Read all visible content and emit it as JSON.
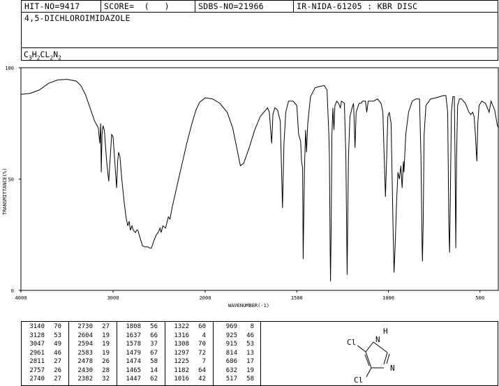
{
  "header": {
    "hit_no": "HIT-NO=9417",
    "score": "SCORE=  (   )",
    "sdbs_no": "SDBS-NO=21966",
    "ir_nida": "IR-NIDA-61205 : KBR DISC"
  },
  "compound_name": "4,5-DICHLOROIMIDAZOLE",
  "formula": {
    "parts": [
      {
        "t": "C",
        "sub": "3"
      },
      {
        "t": "H",
        "sub": "2"
      },
      {
        "t": "CL",
        "sub": "2"
      },
      {
        "t": "N",
        "sub": "2"
      }
    ]
  },
  "structure_labels": {
    "h": "H",
    "n_top": "N",
    "n_bottom": "N",
    "cl_upper": "Cl",
    "cl_lower": "Cl"
  },
  "chart_data": {
    "type": "line",
    "title": "",
    "xlabel": "WAVENUMBER(-1)",
    "ylabel": "TRANSMITTANCE(%)",
    "xlim": [
      4000,
      400
    ],
    "ylim": [
      0,
      100
    ],
    "x_ticks": [
      4000,
      3000,
      2000,
      1500,
      1000,
      500
    ],
    "y_ticks": [
      0,
      50,
      100
    ],
    "grid": false,
    "series": [
      {
        "points": [
          [
            4000,
            88
          ],
          [
            3900,
            88.5
          ],
          [
            3800,
            90
          ],
          [
            3700,
            93
          ],
          [
            3600,
            94.5
          ],
          [
            3500,
            94.8
          ],
          [
            3400,
            94
          ],
          [
            3350,
            92
          ],
          [
            3300,
            88
          ],
          [
            3250,
            82
          ],
          [
            3200,
            76
          ],
          [
            3160,
            73
          ],
          [
            3145,
            66
          ],
          [
            3140,
            70
          ],
          [
            3135,
            75
          ],
          [
            3128,
            53
          ],
          [
            3120,
            70
          ],
          [
            3110,
            74
          ],
          [
            3095,
            72
          ],
          [
            3070,
            58
          ],
          [
            3047,
            49
          ],
          [
            3030,
            60
          ],
          [
            3015,
            70
          ],
          [
            3000,
            69
          ],
          [
            2985,
            60
          ],
          [
            2961,
            46
          ],
          [
            2950,
            58
          ],
          [
            2940,
            62
          ],
          [
            2925,
            60
          ],
          [
            2905,
            50
          ],
          [
            2880,
            40
          ],
          [
            2860,
            33
          ],
          [
            2840,
            29
          ],
          [
            2825,
            31
          ],
          [
            2811,
            27
          ],
          [
            2795,
            29
          ],
          [
            2780,
            27
          ],
          [
            2757,
            26
          ],
          [
            2745,
            27
          ],
          [
            2740,
            27
          ],
          [
            2730,
            27
          ],
          [
            2710,
            24
          ],
          [
            2680,
            20
          ],
          [
            2650,
            19.5
          ],
          [
            2620,
            19.5
          ],
          [
            2604,
            19
          ],
          [
            2594,
            19
          ],
          [
            2583,
            19
          ],
          [
            2560,
            22
          ],
          [
            2530,
            25
          ],
          [
            2510,
            26
          ],
          [
            2490,
            28
          ],
          [
            2478,
            26
          ],
          [
            2460,
            29
          ],
          [
            2430,
            28
          ],
          [
            2400,
            33
          ],
          [
            2382,
            32
          ],
          [
            2360,
            37
          ],
          [
            2300,
            48
          ],
          [
            2250,
            57
          ],
          [
            2200,
            66
          ],
          [
            2150,
            74
          ],
          [
            2100,
            81
          ],
          [
            2060,
            84.5
          ],
          [
            2030,
            85.5
          ],
          [
            2000,
            86.5
          ],
          [
            1960,
            86
          ],
          [
            1920,
            84
          ],
          [
            1880,
            80
          ],
          [
            1850,
            73
          ],
          [
            1830,
            65
          ],
          [
            1808,
            56
          ],
          [
            1790,
            57
          ],
          [
            1760,
            64
          ],
          [
            1730,
            72
          ],
          [
            1700,
            78
          ],
          [
            1680,
            80
          ],
          [
            1660,
            82
          ],
          [
            1650,
            80
          ],
          [
            1637,
            66
          ],
          [
            1630,
            79
          ],
          [
            1620,
            82
          ],
          [
            1605,
            81
          ],
          [
            1590,
            76
          ],
          [
            1578,
            37
          ],
          [
            1570,
            66
          ],
          [
            1560,
            80
          ],
          [
            1545,
            85
          ],
          [
            1520,
            85
          ],
          [
            1500,
            83
          ],
          [
            1490,
            70
          ],
          [
            1479,
            67
          ],
          [
            1474,
            58
          ],
          [
            1468,
            55
          ],
          [
            1465,
            14
          ],
          [
            1458,
            55
          ],
          [
            1452,
            72
          ],
          [
            1447,
            62
          ],
          [
            1440,
            75
          ],
          [
            1425,
            87
          ],
          [
            1400,
            91
          ],
          [
            1380,
            91.5
          ],
          [
            1350,
            92
          ],
          [
            1335,
            90
          ],
          [
            1325,
            70
          ],
          [
            1322,
            60
          ],
          [
            1318,
            20
          ],
          [
            1316,
            4
          ],
          [
            1312,
            30
          ],
          [
            1308,
            70
          ],
          [
            1303,
            82
          ],
          [
            1297,
            72
          ],
          [
            1292,
            83
          ],
          [
            1282,
            85
          ],
          [
            1272,
            84
          ],
          [
            1262,
            82
          ],
          [
            1256,
            85
          ],
          [
            1240,
            84
          ],
          [
            1232,
            60
          ],
          [
            1225,
            7
          ],
          [
            1218,
            60
          ],
          [
            1210,
            78
          ],
          [
            1198,
            82
          ],
          [
            1190,
            84
          ],
          [
            1182,
            64
          ],
          [
            1176,
            80
          ],
          [
            1168,
            82
          ],
          [
            1160,
            84
          ],
          [
            1150,
            84
          ],
          [
            1140,
            85
          ],
          [
            1125,
            85
          ],
          [
            1118,
            80
          ],
          [
            1110,
            85
          ],
          [
            1100,
            85
          ],
          [
            1080,
            85
          ],
          [
            1060,
            86
          ],
          [
            1040,
            84
          ],
          [
            1030,
            80
          ],
          [
            1023,
            60
          ],
          [
            1016,
            42
          ],
          [
            1010,
            58
          ],
          [
            1003,
            78
          ],
          [
            995,
            80
          ],
          [
            985,
            75
          ],
          [
            975,
            30
          ],
          [
            969,
            8
          ],
          [
            963,
            20
          ],
          [
            955,
            40
          ],
          [
            948,
            53
          ],
          [
            940,
            50
          ],
          [
            932,
            56
          ],
          [
            925,
            46
          ],
          [
            918,
            58
          ],
          [
            915,
            53
          ],
          [
            905,
            70
          ],
          [
            890,
            80
          ],
          [
            870,
            85
          ],
          [
            850,
            86
          ],
          [
            830,
            86
          ],
          [
            822,
            60
          ],
          [
            816,
            20
          ],
          [
            814,
            13
          ],
          [
            810,
            30
          ],
          [
            805,
            70
          ],
          [
            795,
            83
          ],
          [
            770,
            86
          ],
          [
            740,
            86.5
          ],
          [
            720,
            87
          ],
          [
            700,
            87.5
          ],
          [
            686,
            87.5
          ],
          [
            676,
            80
          ],
          [
            670,
            30
          ],
          [
            666,
            17
          ],
          [
            662,
            40
          ],
          [
            656,
            80
          ],
          [
            648,
            87
          ],
          [
            640,
            87
          ],
          [
            636,
            60
          ],
          [
            632,
            19
          ],
          [
            628,
            60
          ],
          [
            622,
            83
          ],
          [
            612,
            86
          ],
          [
            600,
            86
          ],
          [
            590,
            85
          ],
          [
            580,
            84
          ],
          [
            570,
            82
          ],
          [
            560,
            80
          ],
          [
            550,
            79
          ],
          [
            540,
            80
          ],
          [
            532,
            78
          ],
          [
            525,
            70
          ],
          [
            520,
            62
          ],
          [
            517,
            58
          ],
          [
            512,
            75
          ],
          [
            505,
            83
          ],
          [
            490,
            85
          ],
          [
            470,
            84
          ],
          [
            450,
            80
          ],
          [
            440,
            85
          ],
          [
            420,
            81
          ],
          [
            405,
            74
          ],
          [
            400,
            73
          ]
        ]
      }
    ]
  },
  "peak_table": [
    [
      [
        "3140",
        "70"
      ],
      [
        "3128",
        "53"
      ],
      [
        "3047",
        "49"
      ],
      [
        "2961",
        "46"
      ],
      [
        "2811",
        "27"
      ],
      [
        "2757",
        "26"
      ],
      [
        "2740",
        "27"
      ]
    ],
    [
      [
        "2730",
        "27"
      ],
      [
        "2604",
        "19"
      ],
      [
        "2594",
        "19"
      ],
      [
        "2583",
        "19"
      ],
      [
        "2478",
        "26"
      ],
      [
        "2430",
        "28"
      ],
      [
        "2382",
        "32"
      ]
    ],
    [
      [
        "1808",
        "56"
      ],
      [
        "1637",
        "66"
      ],
      [
        "1578",
        "37"
      ],
      [
        "1479",
        "67"
      ],
      [
        "1474",
        "58"
      ],
      [
        "1465",
        "14"
      ],
      [
        "1447",
        "62"
      ]
    ],
    [
      [
        "1322",
        "60"
      ],
      [
        "1316",
        "4"
      ],
      [
        "1308",
        "70"
      ],
      [
        "1297",
        "72"
      ],
      [
        "1225",
        "7"
      ],
      [
        "1182",
        "64"
      ],
      [
        "1016",
        "42"
      ]
    ],
    [
      [
        "969",
        "8"
      ],
      [
        "925",
        "46"
      ],
      [
        "915",
        "53"
      ],
      [
        "814",
        "13"
      ],
      [
        "686",
        "17"
      ],
      [
        "632",
        "19"
      ],
      [
        "517",
        "58"
      ]
    ]
  ]
}
